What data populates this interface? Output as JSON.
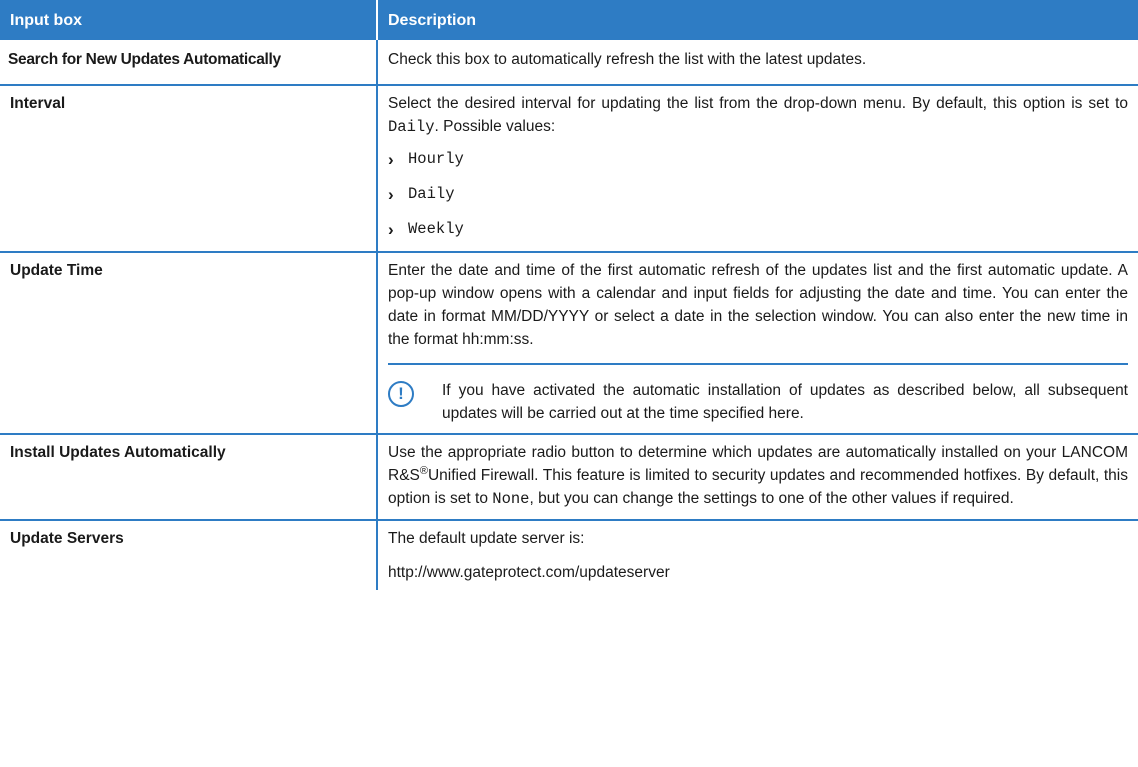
{
  "header": {
    "col1": "Input box",
    "col2": "Description"
  },
  "rows": {
    "search": {
      "name": "Search for New Updates Automatically",
      "desc": "Check this box to automatically refresh the list with the latest updates."
    },
    "interval": {
      "name": "Interval",
      "desc_a": "Select the desired interval for updating the list from the drop-down menu. By default, this option is set to",
      "desc_default": "Daily",
      "desc_b": ". Possible values:",
      "options": [
        "Hourly",
        "Daily",
        "Weekly"
      ]
    },
    "update_time": {
      "name": "Update Time",
      "desc": "Enter the date and time of the first automatic refresh of the updates list and the first automatic update. A pop-up window opens with a calendar and input fields for adjusting the date and time. You can enter the date in format MM/DD/YYYY or select a date in the selection window. You can also enter the new time in the format hh:mm:ss.",
      "note": "If you have activated the automatic installation of updates as described below, all subsequent updates will be carried out at the time specified here."
    },
    "install": {
      "name": "Install Updates Automatically",
      "desc_a": "Use the appropriate radio button to determine which updates are automatically installed on your LANCOM R&S",
      "desc_reg": "®",
      "desc_b": "Unified Firewall. This feature is limited to security updates and recommended hotfixes. By default, this option is set to",
      "desc_default": "None",
      "desc_c": ", but you can change the settings to one of the other values if required."
    },
    "servers": {
      "name": "Update Servers",
      "desc": "The default update server is:",
      "url": "http://www.gateprotect.com/updateserver"
    }
  },
  "icons": {
    "note": "exclamation-circle-icon",
    "bullet": "chevron-right-icon"
  },
  "colors": {
    "accent": "#2e7cc4"
  }
}
